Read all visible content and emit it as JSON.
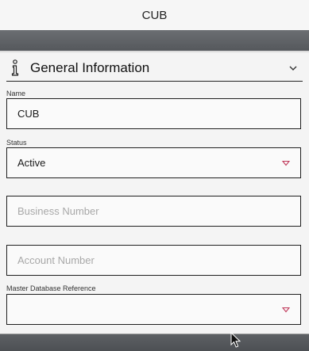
{
  "window": {
    "title": "CUB"
  },
  "section": {
    "title": "General Information",
    "icon": "info-icon",
    "toggle_icon": "chevron-down-icon"
  },
  "fields": {
    "name": {
      "label": "Name",
      "value": "CUB"
    },
    "status": {
      "label": "Status",
      "value": "Active",
      "icon": "dropdown-caret-icon"
    },
    "business_number": {
      "placeholder": "Business Number"
    },
    "account_number": {
      "placeholder": "Account Number"
    },
    "master_db_ref": {
      "label": "Master Database Reference",
      "value": "",
      "icon": "dropdown-caret-icon"
    }
  },
  "colors": {
    "caret": "#c0395a",
    "band": "#5f6266",
    "field_border": "#1f1f1f",
    "placeholder": "#a8a8a8"
  }
}
